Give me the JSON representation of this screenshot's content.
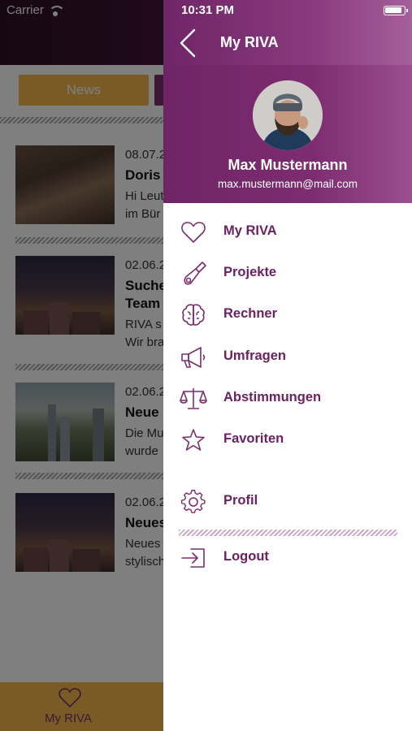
{
  "status_bar": {
    "carrier": "Carrier",
    "time": "10:31 PM"
  },
  "background": {
    "tabs": {
      "news_label": "News"
    },
    "news": [
      {
        "date": "08.07.2",
        "title": "Doris",
        "line1": "Hi Leut",
        "line2": "im Bür"
      },
      {
        "date": "02.06.2",
        "title": "Suche",
        "title2": "Team",
        "line1": "RIVA s",
        "line2": "Wir bra"
      },
      {
        "date": "02.06.2",
        "title": "Neue",
        "line1": "Die Mu",
        "line2": "wurde"
      },
      {
        "date": "02.06.2",
        "title": "Neues",
        "line1": "Neues",
        "line2": "stylisch"
      }
    ],
    "bottom_tab": {
      "label": "My RIVA",
      "icon": "heart-icon"
    }
  },
  "drawer": {
    "title": "My RIVA",
    "user": {
      "name": "Max Mustermann",
      "email": "max.mustermann@mail.com"
    },
    "menu": [
      {
        "label": "My RIVA",
        "icon": "heart-icon"
      },
      {
        "label": "Projekte",
        "icon": "flashlight-icon"
      },
      {
        "label": "Rechner",
        "icon": "brain-icon"
      },
      {
        "label": "Umfragen",
        "icon": "megaphone-icon"
      },
      {
        "label": "Abstimmungen",
        "icon": "scales-icon"
      },
      {
        "label": "Favoriten",
        "icon": "star-icon"
      }
    ],
    "profile": {
      "label": "Profil",
      "icon": "gear-icon"
    },
    "logout": {
      "label": "Logout",
      "icon": "logout-icon"
    },
    "colors": {
      "accent": "#6a2261",
      "brand_gold": "#f3b84a"
    }
  }
}
